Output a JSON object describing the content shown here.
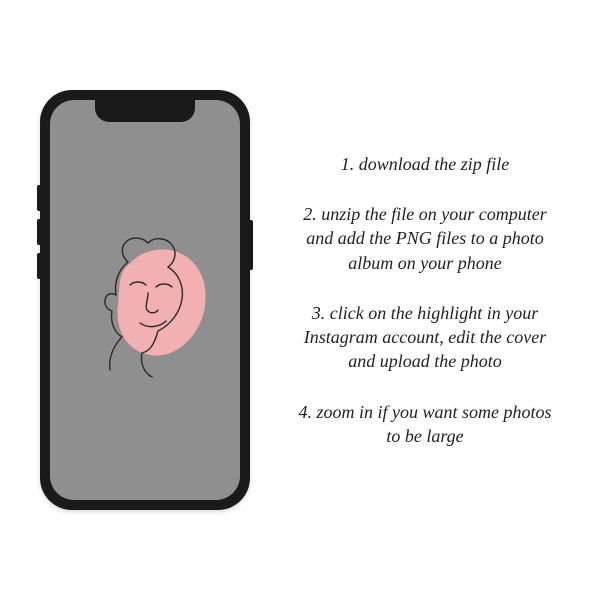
{
  "instructions": {
    "steps": [
      "1. download the zip file",
      "2. unzip the file on your computer and add the PNG files to a photo album on your phone",
      "3. click on the highlight in your Instagram account, edit the cover and upload the photo",
      "4. zoom in if you want some photos to be large"
    ]
  },
  "art": {
    "blob_color": "#f2b0b2",
    "line_color": "#2b2b2b"
  }
}
